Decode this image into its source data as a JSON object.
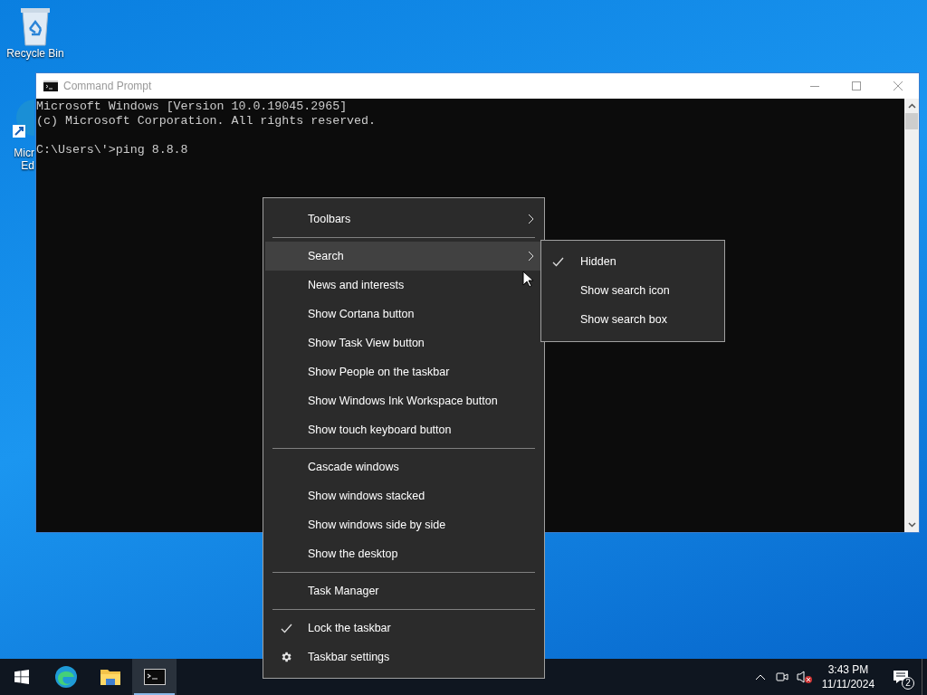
{
  "desktop_icons": [
    {
      "kind": "recycle",
      "label_lines": [
        "Recycle Bin"
      ]
    },
    {
      "kind": "edge",
      "label_lines": [
        "Micr",
        "Ed"
      ]
    }
  ],
  "window": {
    "title": "Command Prompt",
    "console_blocks": [
      [
        "Microsoft Windows [Version 10.0.19045.2965]",
        "(c) Microsoft Corporation. All rights reserved."
      ],
      [
        "C:\\Users\\'>ping 8.8.8"
      ]
    ]
  },
  "context_menu": {
    "items": [
      {
        "kind": "submenu",
        "label": "Toolbars",
        "checked": false,
        "selected": false
      },
      {
        "kind": "separator"
      },
      {
        "kind": "submenu",
        "label": "Search",
        "checked": false,
        "selected": true
      },
      {
        "kind": "item",
        "label": "News and interests",
        "checked": false,
        "selected": false
      },
      {
        "kind": "item",
        "label": "Show Cortana button",
        "checked": false,
        "selected": false
      },
      {
        "kind": "item",
        "label": "Show Task View button",
        "checked": false,
        "selected": false
      },
      {
        "kind": "item",
        "label": "Show People on the taskbar",
        "checked": false,
        "selected": false
      },
      {
        "kind": "item",
        "label": "Show Windows Ink Workspace button",
        "checked": false,
        "selected": false
      },
      {
        "kind": "item",
        "label": "Show touch keyboard button",
        "checked": false,
        "selected": false
      },
      {
        "kind": "separator"
      },
      {
        "kind": "item",
        "label": "Cascade windows",
        "checked": false,
        "selected": false
      },
      {
        "kind": "item",
        "label": "Show windows stacked",
        "checked": false,
        "selected": false
      },
      {
        "kind": "item",
        "label": "Show windows side by side",
        "checked": false,
        "selected": false
      },
      {
        "kind": "item",
        "label": "Show the desktop",
        "checked": false,
        "selected": false
      },
      {
        "kind": "separator"
      },
      {
        "kind": "item",
        "label": "Task Manager",
        "checked": false,
        "selected": false
      },
      {
        "kind": "separator"
      },
      {
        "kind": "item",
        "label": "Lock the taskbar",
        "checked": true,
        "selected": false
      },
      {
        "kind": "settings",
        "label": "Taskbar settings",
        "checked": false,
        "selected": false
      }
    ]
  },
  "search_submenu": {
    "items": [
      {
        "label": "Hidden",
        "checked": true
      },
      {
        "label": "Show search icon",
        "checked": false
      },
      {
        "label": "Show search box",
        "checked": false
      }
    ]
  },
  "taskbar": {
    "apps": [
      {
        "kind": "edge",
        "selected": false
      },
      {
        "kind": "explorer",
        "selected": false
      },
      {
        "kind": "cmd",
        "selected": true
      }
    ],
    "time": "3:43 PM",
    "date": "11/11/2024",
    "notification_count": "2"
  }
}
